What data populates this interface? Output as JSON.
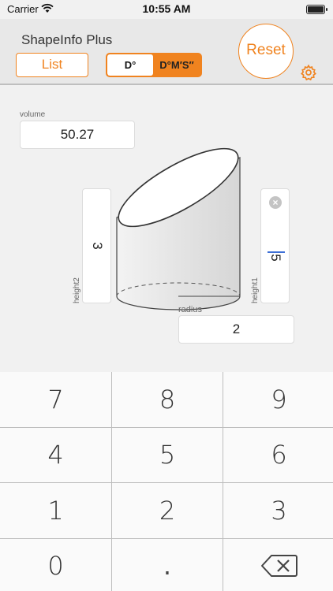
{
  "status_bar": {
    "carrier": "Carrier",
    "time": "10:55 AM"
  },
  "header": {
    "title": "ShapeInfo Plus",
    "list_label": "List",
    "segment": {
      "option_a": "D°",
      "option_b": "D°M′S″",
      "selected": "D°"
    },
    "reset_label": "Reset",
    "settings_icon": "gear-icon",
    "accent_color": "#f0831f"
  },
  "fields": {
    "volume": {
      "label": "volume",
      "value": "50.27"
    },
    "height2": {
      "label": "height2",
      "value": "3"
    },
    "height1": {
      "label": "height1",
      "value": "5"
    },
    "radius": {
      "label": "radius",
      "value": "2"
    }
  },
  "keypad": {
    "keys": [
      "7",
      "8",
      "9",
      "4",
      "5",
      "6",
      "1",
      "2",
      "3",
      "0",
      ".",
      "delete"
    ]
  }
}
